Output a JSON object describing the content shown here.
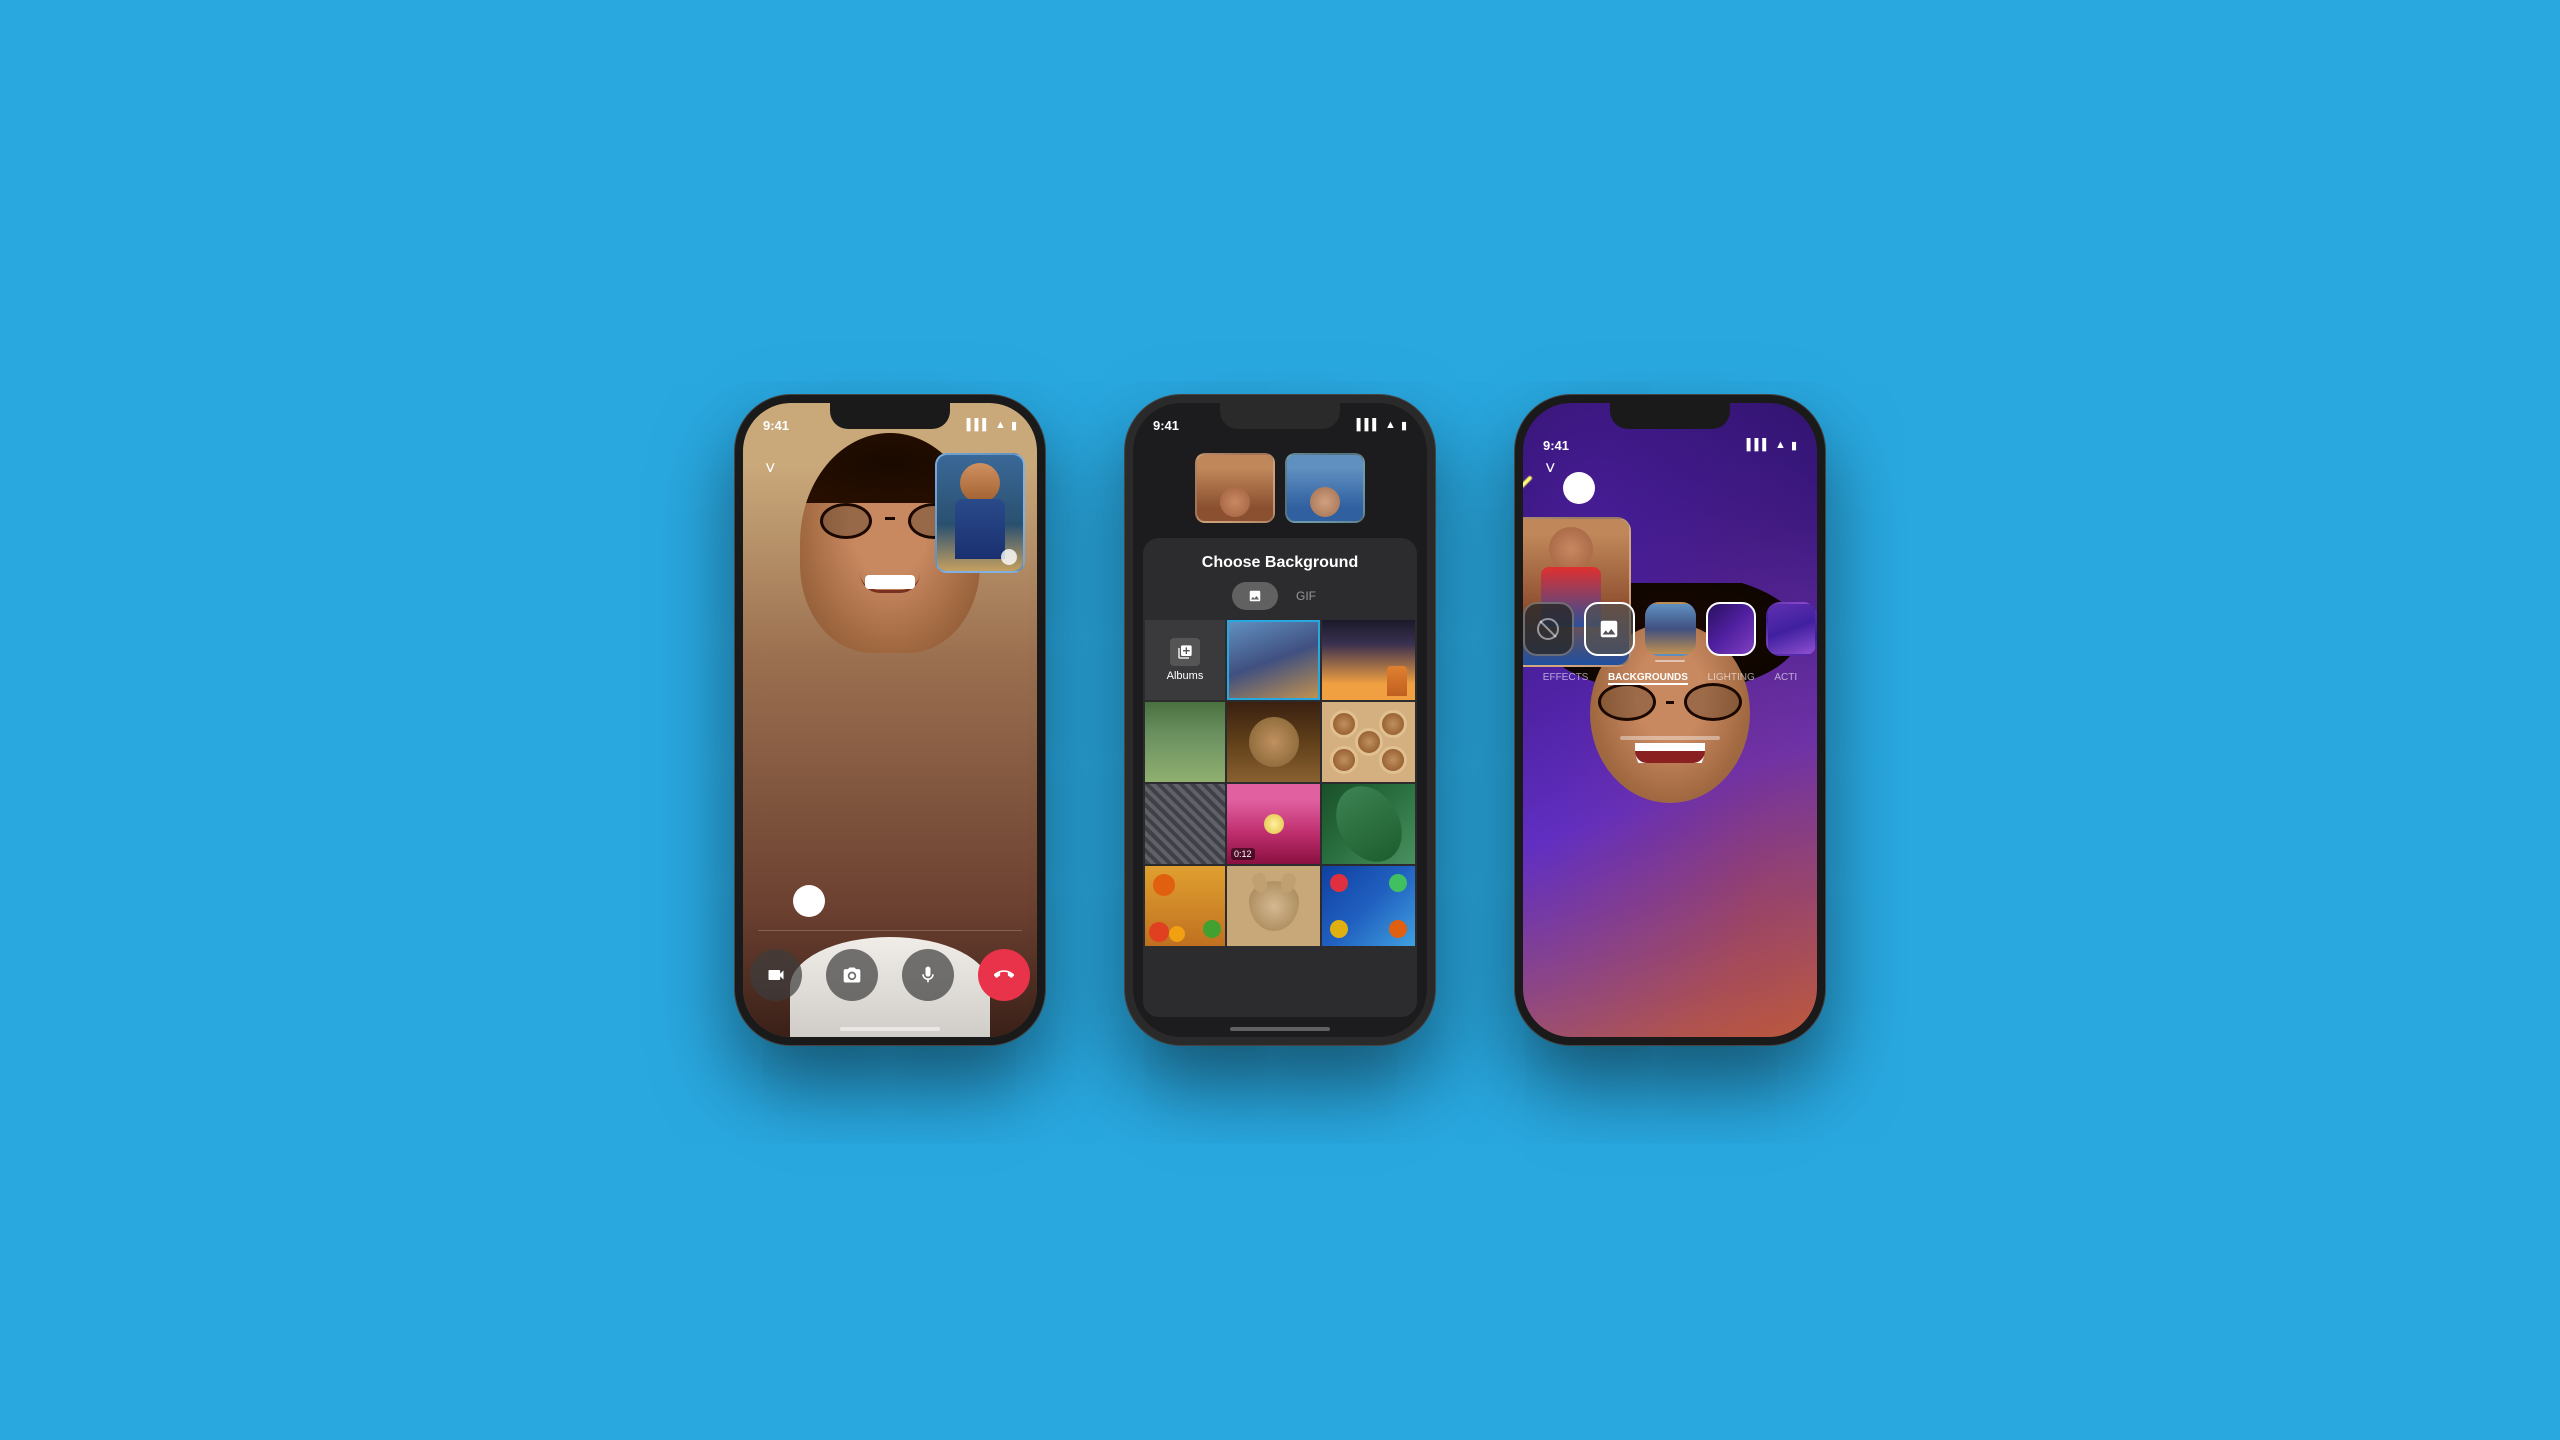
{
  "background": {
    "color": "#29a8e0"
  },
  "phones": {
    "left": {
      "status_time": "9:41",
      "chevron": "chevron-down",
      "controls": {
        "camera_flip": "⇄",
        "switch_camera": "📷",
        "mute": "🎙",
        "end_call": "📞"
      }
    },
    "center": {
      "status_time": "9:41",
      "panel_title": "Choose Background",
      "tab_photos_label": "Photos",
      "tab_gif_label": "GIF",
      "albums_label": "Albums",
      "video_duration": "0:12"
    },
    "right": {
      "status_time": "9:41",
      "chevron": "chevron-down",
      "tabs": {
        "effects": "EFFECTS",
        "backgrounds": "BACKGROUNDS",
        "lighting": "LIGHTING",
        "activity": "ACTI"
      }
    }
  }
}
